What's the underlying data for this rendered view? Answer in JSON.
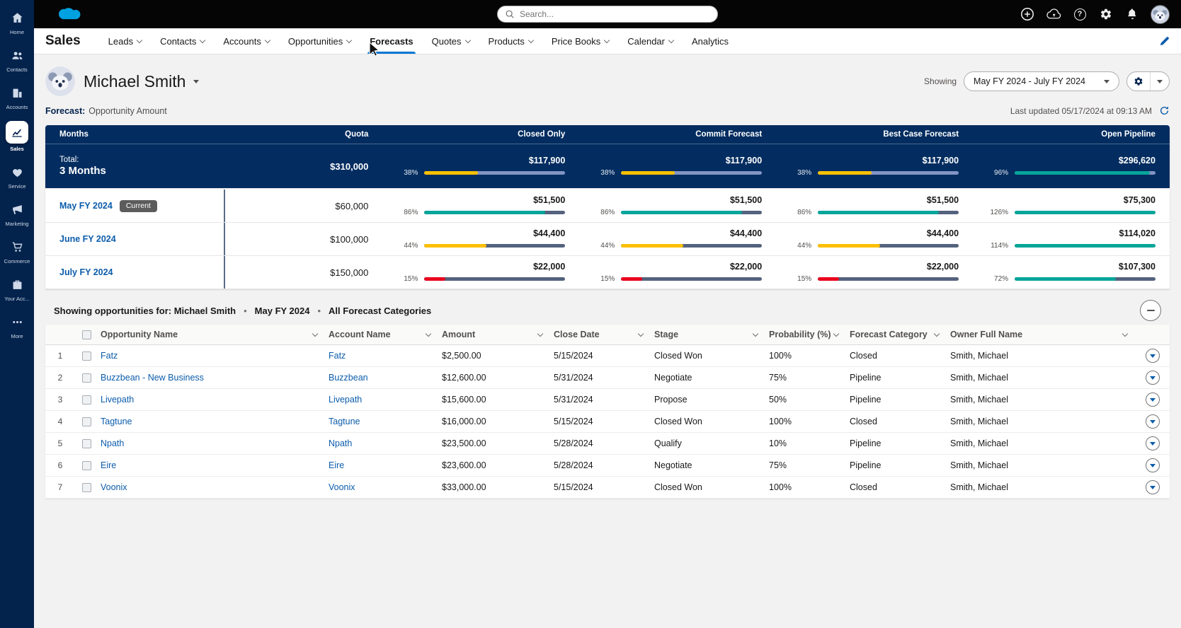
{
  "colors": {
    "navy": "#032d60",
    "sidebar": "#03234d",
    "link": "#0b5cab",
    "accent": "#0176d3",
    "teal": "#06a59a",
    "gold": "#fcc003",
    "red": "#ea001e",
    "page": "#f3f2f2"
  },
  "global_header": {
    "search": {
      "placeholder": "Search..."
    },
    "icons": [
      "add-icon",
      "upload-cloud-icon",
      "help-icon",
      "setup-gear-icon",
      "notifications-bell-icon",
      "user-avatar"
    ]
  },
  "sidebar": {
    "items": [
      {
        "label": "Home",
        "icon": "home-icon",
        "active": false
      },
      {
        "label": "Contacts",
        "icon": "contacts-icon",
        "active": false
      },
      {
        "label": "Accounts",
        "icon": "accounts-icon",
        "active": false
      },
      {
        "label": "Sales",
        "icon": "sales-icon",
        "active": true
      },
      {
        "label": "Service",
        "icon": "service-icon",
        "active": false
      },
      {
        "label": "Marketing",
        "icon": "marketing-icon",
        "active": false
      },
      {
        "label": "Commerce",
        "icon": "commerce-icon",
        "active": false
      },
      {
        "label": "Your Acc...",
        "icon": "your-account-icon",
        "active": false
      },
      {
        "label": "More",
        "icon": "more-icon",
        "active": false
      }
    ]
  },
  "app_nav": {
    "app_name": "Sales",
    "tabs": [
      {
        "label": "Leads",
        "has_menu": true,
        "active": false
      },
      {
        "label": "Contacts",
        "has_menu": true,
        "active": false
      },
      {
        "label": "Accounts",
        "has_menu": true,
        "active": false
      },
      {
        "label": "Opportunities",
        "has_menu": true,
        "active": false
      },
      {
        "label": "Forecasts",
        "has_menu": false,
        "active": true
      },
      {
        "label": "Quotes",
        "has_menu": true,
        "active": false
      },
      {
        "label": "Products",
        "has_menu": true,
        "active": false
      },
      {
        "label": "Price Books",
        "has_menu": true,
        "active": false
      },
      {
        "label": "Calendar",
        "has_menu": true,
        "active": false
      },
      {
        "label": "Analytics",
        "has_menu": false,
        "active": false
      }
    ]
  },
  "page_header": {
    "user_name": "Michael Smith",
    "showing_label": "Showing",
    "period_selector": "May FY 2024 - July FY 2024",
    "forecast_label": "Forecast:",
    "forecast_type": "Opportunity Amount",
    "last_updated": "Last updated 05/17/2024 at 09:13 AM"
  },
  "forecast_table": {
    "columns": [
      "Months",
      "Quota",
      "Closed Only",
      "Commit Forecast",
      "Best Case Forecast",
      "Open Pipeline"
    ],
    "total_row": {
      "label_prefix": "Total:",
      "label": "3 Months",
      "quota": "$310,000",
      "cells": [
        {
          "pct": "38%",
          "value": "$117,900",
          "fill": 38,
          "color": "gold"
        },
        {
          "pct": "38%",
          "value": "$117,900",
          "fill": 38,
          "color": "gold"
        },
        {
          "pct": "38%",
          "value": "$117,900",
          "fill": 38,
          "color": "gold"
        },
        {
          "pct": "96%",
          "value": "$296,620",
          "fill": 96,
          "color": "teal"
        }
      ]
    },
    "rows": [
      {
        "month": "May FY 2024",
        "badge": "Current",
        "quota": "$60,000",
        "cells": [
          {
            "pct": "86%",
            "value": "$51,500",
            "fill": 86,
            "color": "teal"
          },
          {
            "pct": "86%",
            "value": "$51,500",
            "fill": 86,
            "color": "teal"
          },
          {
            "pct": "86%",
            "value": "$51,500",
            "fill": 86,
            "color": "teal"
          },
          {
            "pct": "126%",
            "value": "$75,300",
            "fill": 100,
            "color": "teal"
          }
        ]
      },
      {
        "month": "June FY 2024",
        "badge": "",
        "quota": "$100,000",
        "cells": [
          {
            "pct": "44%",
            "value": "$44,400",
            "fill": 44,
            "color": "gold"
          },
          {
            "pct": "44%",
            "value": "$44,400",
            "fill": 44,
            "color": "gold"
          },
          {
            "pct": "44%",
            "value": "$44,400",
            "fill": 44,
            "color": "gold"
          },
          {
            "pct": "114%",
            "value": "$114,020",
            "fill": 100,
            "color": "teal"
          }
        ]
      },
      {
        "month": "July FY 2024",
        "badge": "",
        "quota": "$150,000",
        "cells": [
          {
            "pct": "15%",
            "value": "$22,000",
            "fill": 15,
            "color": "red"
          },
          {
            "pct": "15%",
            "value": "$22,000",
            "fill": 15,
            "color": "red"
          },
          {
            "pct": "15%",
            "value": "$22,000",
            "fill": 15,
            "color": "red"
          },
          {
            "pct": "72%",
            "value": "$107,300",
            "fill": 72,
            "color": "teal"
          }
        ]
      }
    ]
  },
  "opportunities": {
    "title_parts": [
      "Showing opportunities for: Michael Smith",
      "May FY 2024",
      "All Forecast Categories"
    ],
    "columns": [
      "Opportunity Name",
      "Account Name",
      "Amount",
      "Close Date",
      "Stage",
      "Probability (%)",
      "Forecast Category",
      "Owner Full Name"
    ],
    "rows": [
      {
        "num": "1",
        "name": "Fatz",
        "account": "Fatz",
        "amount": "$2,500.00",
        "close_date": "5/15/2024",
        "stage": "Closed Won",
        "probability": "100%",
        "forecast_category": "Closed",
        "owner": "Smith, Michael"
      },
      {
        "num": "2",
        "name": "Buzzbean - New Business",
        "account": "Buzzbean",
        "amount": "$12,600.00",
        "close_date": "5/31/2024",
        "stage": "Negotiate",
        "probability": "75%",
        "forecast_category": "Pipeline",
        "owner": "Smith, Michael"
      },
      {
        "num": "3",
        "name": "Livepath",
        "account": "Livepath",
        "amount": "$15,600.00",
        "close_date": "5/31/2024",
        "stage": "Propose",
        "probability": "50%",
        "forecast_category": "Pipeline",
        "owner": "Smith, Michael"
      },
      {
        "num": "4",
        "name": "Tagtune",
        "account": "Tagtune",
        "amount": "$16,000.00",
        "close_date": "5/15/2024",
        "stage": "Closed Won",
        "probability": "100%",
        "forecast_category": "Closed",
        "owner": "Smith, Michael"
      },
      {
        "num": "5",
        "name": "Npath",
        "account": "Npath",
        "amount": "$23,500.00",
        "close_date": "5/28/2024",
        "stage": "Qualify",
        "probability": "10%",
        "forecast_category": "Pipeline",
        "owner": "Smith, Michael"
      },
      {
        "num": "6",
        "name": "Eire",
        "account": "Eire",
        "amount": "$23,600.00",
        "close_date": "5/28/2024",
        "stage": "Negotiate",
        "probability": "75%",
        "forecast_category": "Pipeline",
        "owner": "Smith, Michael"
      },
      {
        "num": "7",
        "name": "Voonix",
        "account": "Voonix",
        "amount": "$33,000.00",
        "close_date": "5/15/2024",
        "stage": "Closed Won",
        "probability": "100%",
        "forecast_category": "Closed",
        "owner": "Smith, Michael"
      }
    ]
  }
}
